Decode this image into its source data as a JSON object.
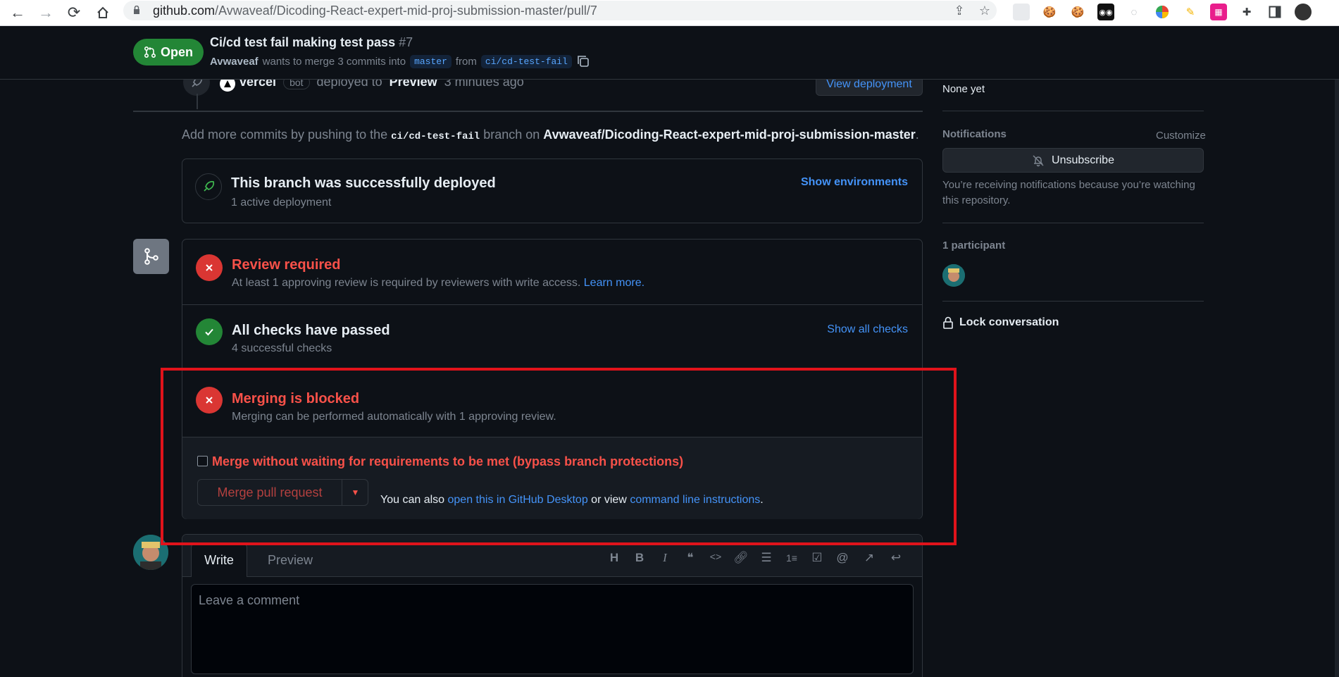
{
  "browser": {
    "url_host": "github.com",
    "url_path": "/Avwaveaf/Dicoding-React-expert-mid-proj-submission-master/pull/7"
  },
  "pr": {
    "state": "Open",
    "title": "Ci/cd test fail making test pass",
    "number": "#7",
    "author": "Avwaveaf",
    "wants_to_merge": "wants to merge 3 commits into",
    "base_branch": "master",
    "from_word": "from",
    "head_branch": "ci/cd-test-fail"
  },
  "deployment_event": {
    "actor": "vercel",
    "bot_badge": "bot",
    "action": "deployed to",
    "environment": "Preview",
    "time": "3 minutes ago",
    "button": "View deployment"
  },
  "hint": {
    "prefix": "Add more commits by pushing to the",
    "branch": "ci/cd-test-fail",
    "middle": "branch on",
    "repo": "Avwaveaf/Dicoding-React-expert-mid-proj-submission-master",
    "suffix": "."
  },
  "deploy_box": {
    "title": "This branch was successfully deployed",
    "subtitle": "1 active deployment",
    "link": "Show environments"
  },
  "merge_box": {
    "review": {
      "title": "Review required",
      "text": "At least 1 approving review is required by reviewers with write access.",
      "link": "Learn more."
    },
    "checks": {
      "title": "All checks have passed",
      "subtitle": "4 successful checks",
      "link": "Show all checks"
    },
    "blocked": {
      "title": "Merging is blocked",
      "subtitle": "Merging can be performed automatically with 1 approving review."
    },
    "bypass_label": "Merge without waiting for requirements to be met (bypass branch protections)",
    "merge_button": "Merge pull request",
    "also_text": "You can also",
    "desktop_link": "open this in GitHub Desktop",
    "or_view": "or view",
    "cli_link": "command line instructions",
    "period": "."
  },
  "editor": {
    "tab_write": "Write",
    "tab_preview": "Preview",
    "placeholder": "Leave a comment",
    "toolbar": [
      "H",
      "B",
      "I",
      "quote",
      "code",
      "link",
      "bullets",
      "numbers",
      "tasks",
      "mention",
      "reference",
      "reply"
    ]
  },
  "sidebar": {
    "milestone_value": "None yet",
    "notifications_label": "Notifications",
    "customize": "Customize",
    "unsubscribe": "Unsubscribe",
    "notice": "You’re receiving notifications because you’re watching this repository.",
    "participants": "1 participant",
    "lock": "Lock conversation"
  },
  "colors": {
    "accent_blue": "#4493f8",
    "success_green": "#238636",
    "danger_red": "#da3633",
    "highlight_red": "#e0131b"
  }
}
